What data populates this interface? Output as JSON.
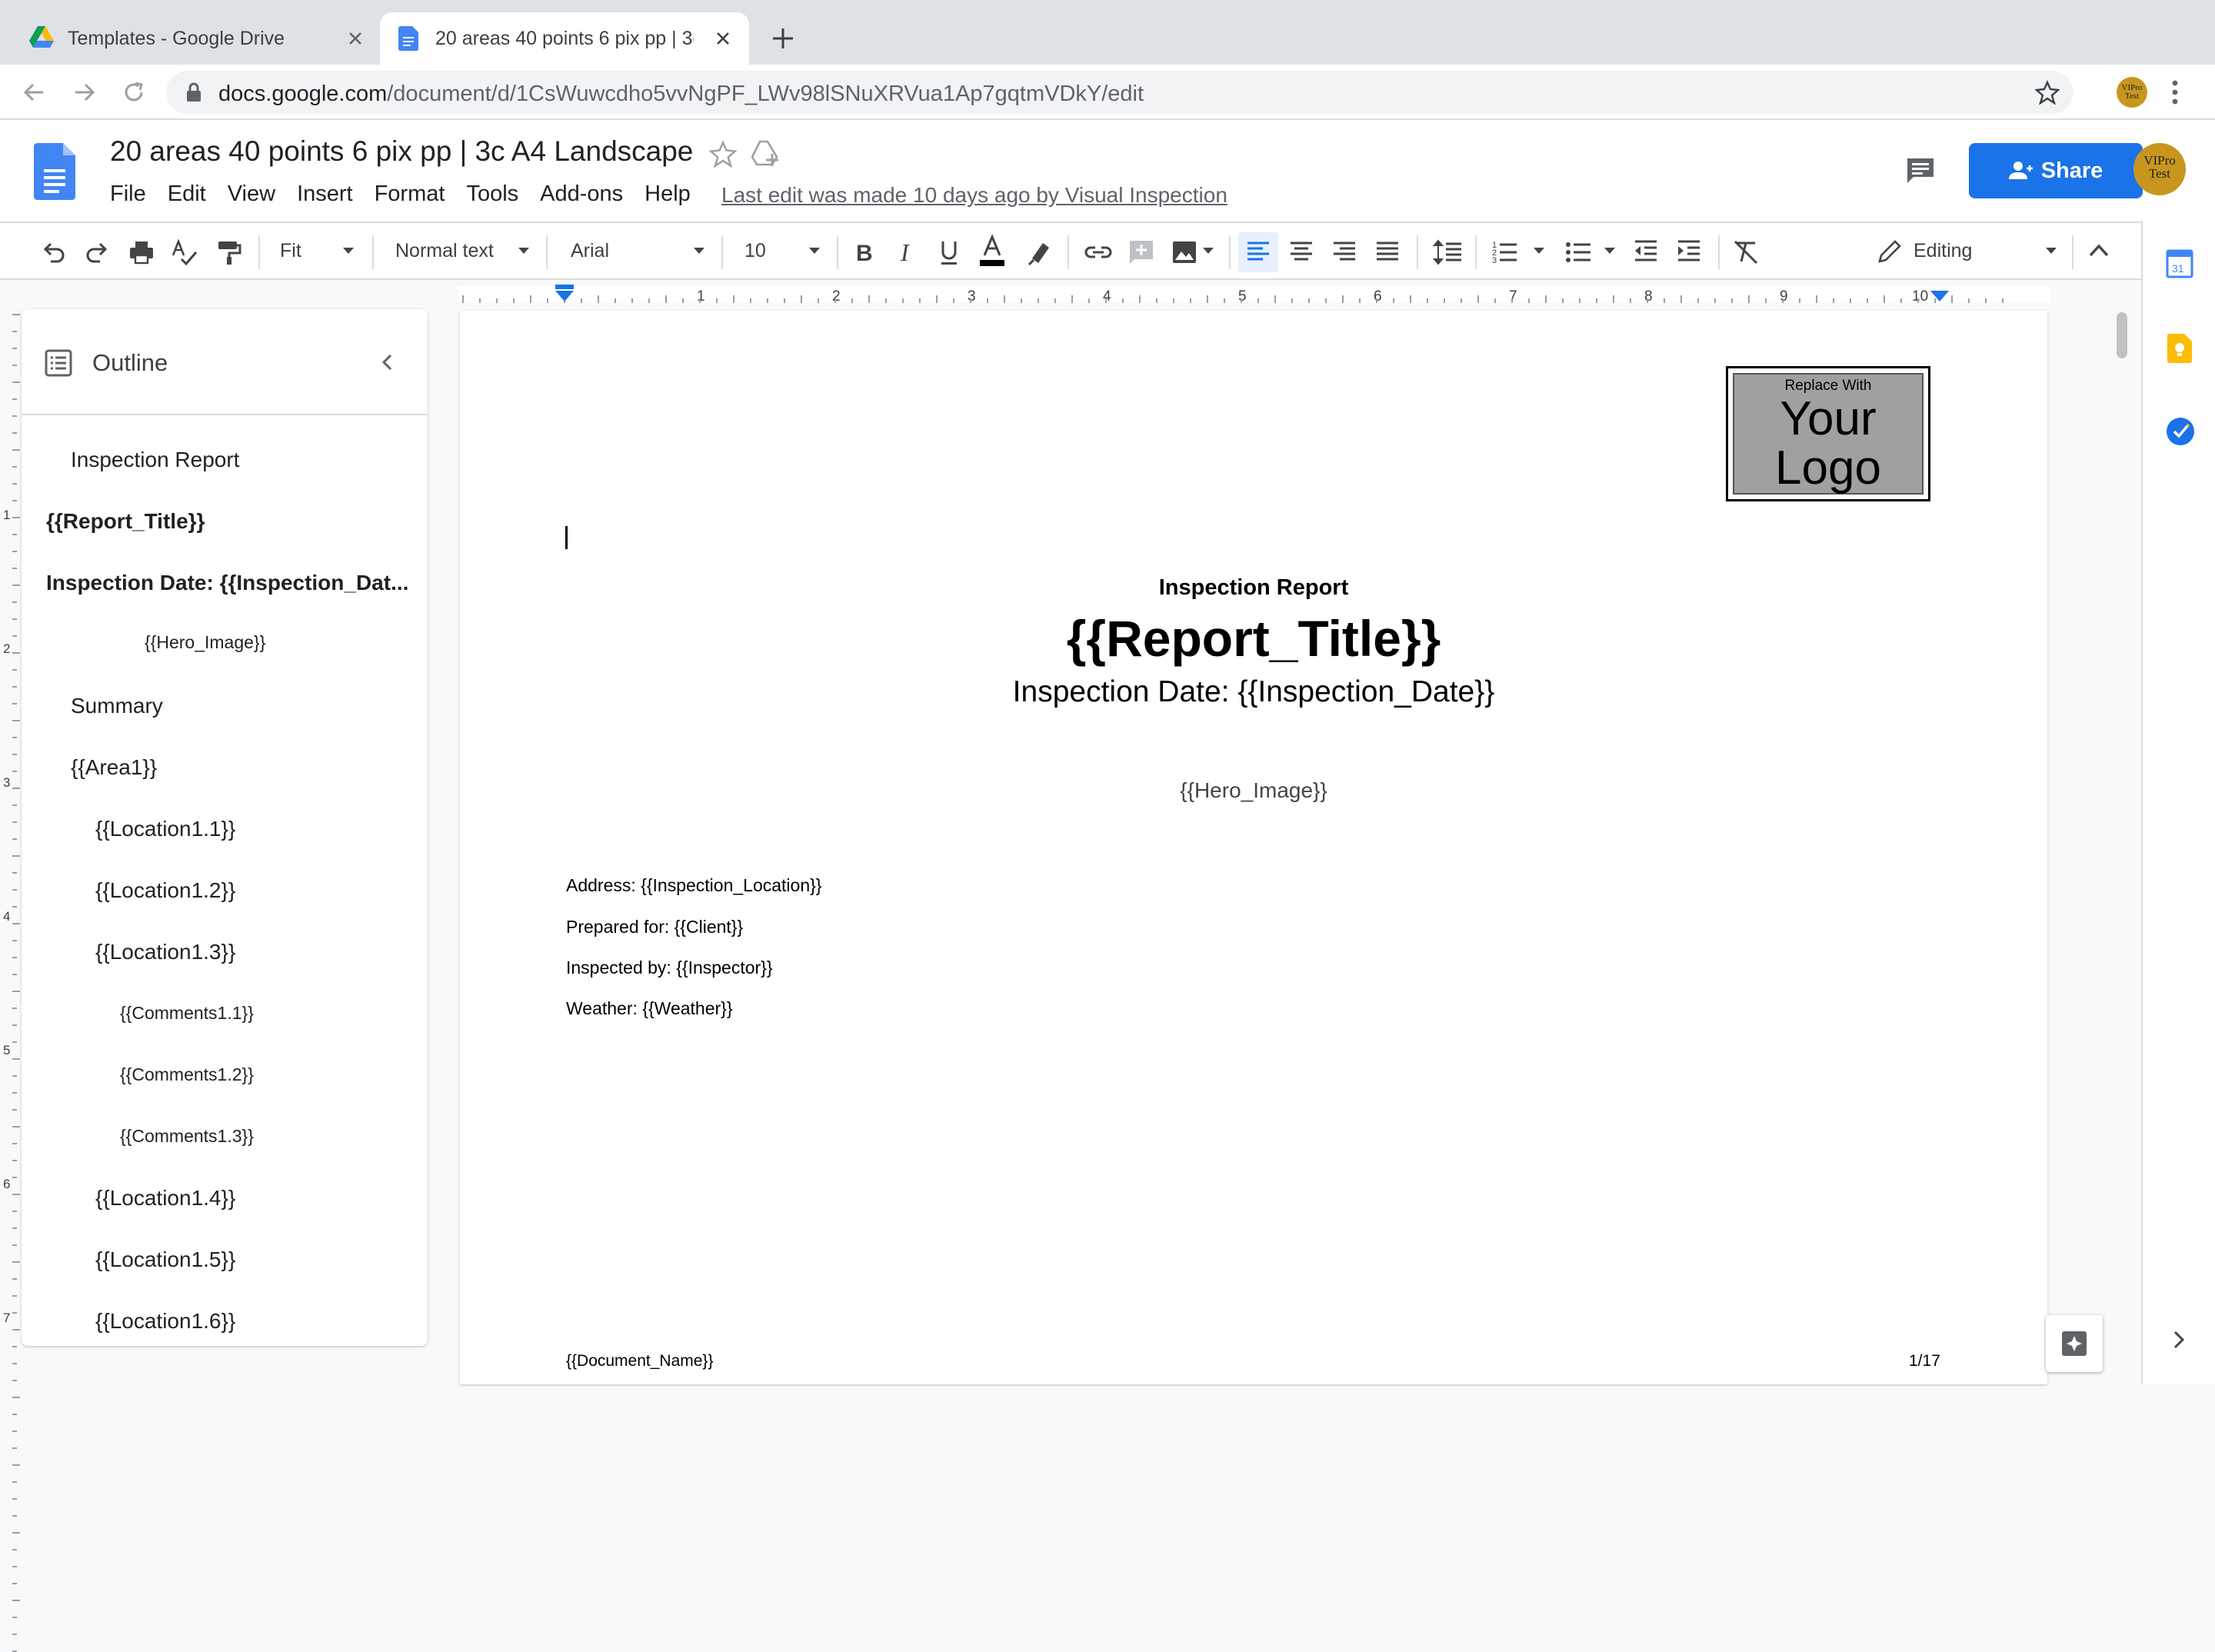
{
  "browser": {
    "tabs": [
      {
        "title": "Templates - Google Drive",
        "active": false
      },
      {
        "title": "20 areas 40 points 6 pix pp | 3c",
        "active": true
      }
    ],
    "url_host": "docs.google.com",
    "url_path": "/document/d/1CsWuwcdho5vvNgPF_LWv98lSNuXRVua1Ap7gqtmVDkY/edit",
    "profile_avatar": "VIPro Test"
  },
  "docs": {
    "title": "20 areas 40 points 6 pix pp | 3c A4 Landscape",
    "menu": [
      "File",
      "Edit",
      "View",
      "Insert",
      "Format",
      "Tools",
      "Add-ons",
      "Help"
    ],
    "last_edit": "Last edit was made 10 days ago by Visual Inspection",
    "share_label": "Share",
    "avatar": "VIPro Test",
    "accent_color": "#1a73e8"
  },
  "toolbar": {
    "zoom": "Fit",
    "style": "Normal text",
    "font": "Arial",
    "size": "10",
    "mode": "Editing"
  },
  "ruler": {
    "numbers": [
      "1",
      "2",
      "3",
      "4",
      "5",
      "6",
      "7",
      "8",
      "9",
      "10"
    ],
    "vnumbers": [
      "1",
      "2",
      "3",
      "4",
      "5",
      "6",
      "7"
    ]
  },
  "outline": {
    "title": "Outline",
    "items": [
      "Inspection Report",
      "{{Report_Title}}",
      "Inspection Date: {{Inspection_Dat...",
      "{{Hero_Image}}",
      "Summary",
      "{{Area1}}",
      "{{Location1.1}}",
      "{{Location1.2}}",
      "{{Location1.3}}",
      "{{Comments1.1}}",
      "{{Comments1.2}}",
      "{{Comments1.3}}",
      "{{Location1.4}}",
      "{{Location1.5}}",
      "{{Location1.6}}"
    ]
  },
  "page": {
    "logo_small": "Replace With",
    "logo_line1": "Your",
    "logo_line2": "Logo",
    "heading": "Inspection Report",
    "report_title": "{{Report_Title}}",
    "inspection_date": "Inspection Date: {{Inspection_Date}}",
    "hero_image": "{{Hero_Image}}",
    "address": "Address: {{Inspection_Location}}",
    "prepared_for": "Prepared for: {{Client}}",
    "inspected_by": "Inspected by: {{Inspector}}",
    "weather": "Weather: {{Weather}}",
    "footer_name": "{{Document_Name}}",
    "page_number": "1/17"
  }
}
